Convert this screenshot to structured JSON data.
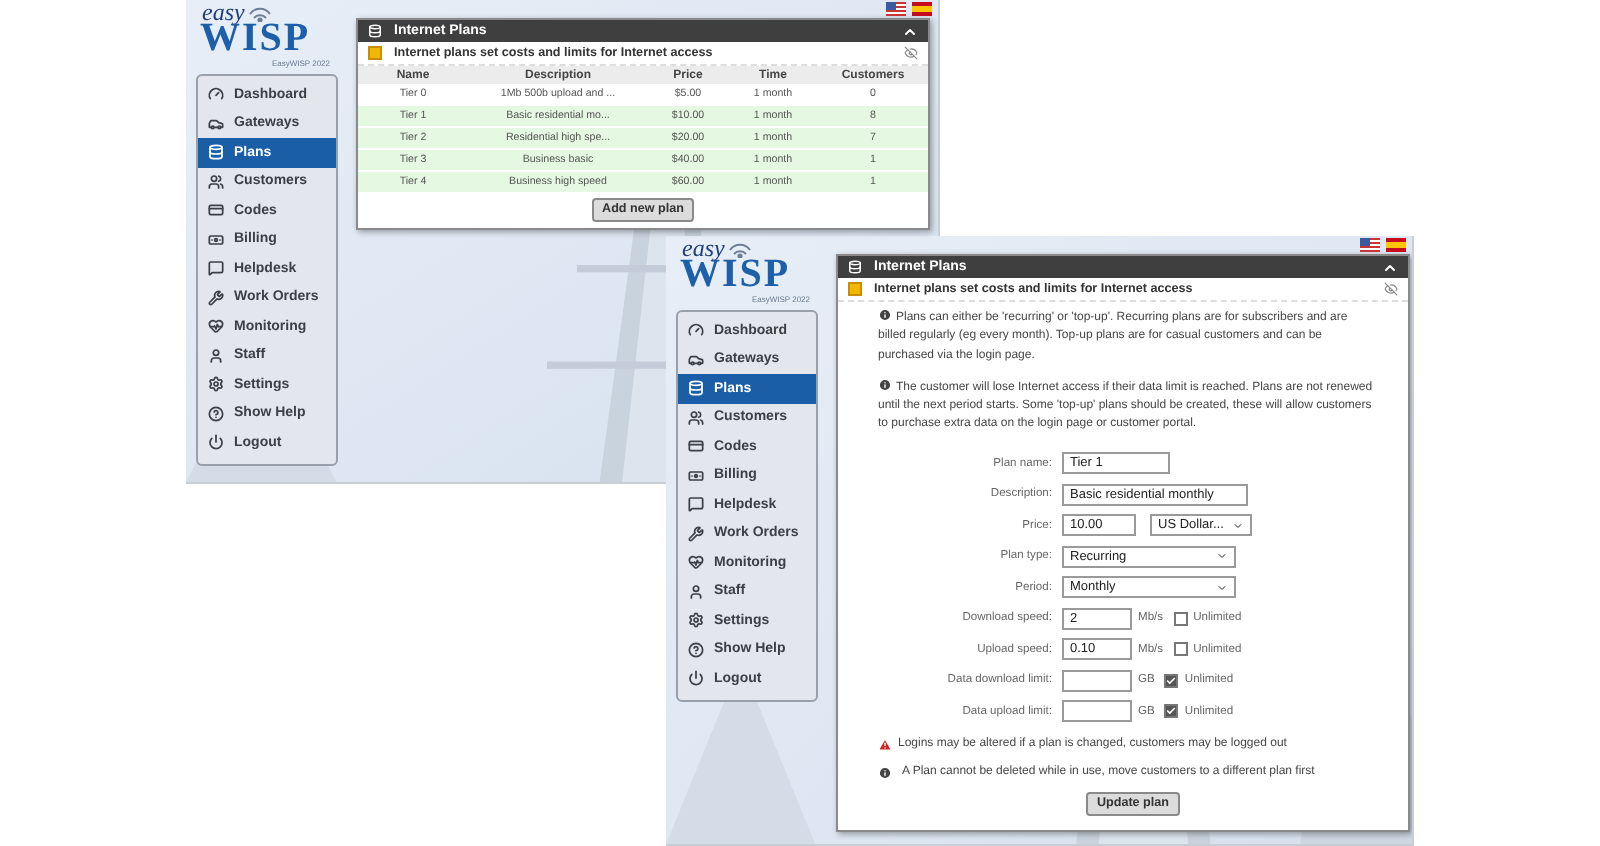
{
  "screens": [
    {
      "logo": {
        "script": "easy",
        "name": "WISP",
        "caption": "EasyWISP 2022"
      },
      "nav": [
        {
          "label": "Dashboard",
          "selected": false
        },
        {
          "label": "Gateways",
          "selected": false
        },
        {
          "label": "Plans",
          "selected": true
        },
        {
          "label": "Customers",
          "selected": false
        },
        {
          "label": "Codes",
          "selected": false
        },
        {
          "label": "Billing",
          "selected": false
        },
        {
          "label": "Helpdesk",
          "selected": false
        },
        {
          "label": "Work Orders",
          "selected": false
        },
        {
          "label": "Monitoring",
          "selected": false
        },
        {
          "label": "Staff",
          "selected": false
        },
        {
          "label": "Settings",
          "selected": false
        },
        {
          "label": "Show Help",
          "selected": false
        },
        {
          "label": "Logout",
          "selected": false
        }
      ],
      "panel": {
        "kind": "table",
        "title": "Internet Plans",
        "subtitle": "Internet plans set costs and limits for Internet access",
        "columns": [
          "Name",
          "Description",
          "Price",
          "Time",
          "Customers"
        ],
        "rows": [
          {
            "cells": [
              "Tier 0",
              "1Mb 500b upload and ...",
              "$5.00",
              "1 month",
              "0"
            ],
            "highlighted": false
          },
          {
            "cells": [
              "Tier 1",
              "Basic residential mo...",
              "$10.00",
              "1 month",
              "8"
            ],
            "highlighted": true
          },
          {
            "cells": [
              "Tier 2",
              "Residential high spe...",
              "$20.00",
              "1 month",
              "7"
            ],
            "highlighted": true
          },
          {
            "cells": [
              "Tier 3",
              "Business basic",
              "$40.00",
              "1 month",
              "1"
            ],
            "highlighted": true
          },
          {
            "cells": [
              "Tier 4",
              "Business high speed",
              "$60.00",
              "1 month",
              "1"
            ],
            "highlighted": true
          }
        ],
        "button": "Add new plan"
      }
    },
    {
      "logo": {
        "script": "easy",
        "name": "WISP",
        "caption": "EasyWISP 2022"
      },
      "nav": [
        {
          "label": "Dashboard",
          "selected": false
        },
        {
          "label": "Gateways",
          "selected": false
        },
        {
          "label": "Plans",
          "selected": true
        },
        {
          "label": "Customers",
          "selected": false
        },
        {
          "label": "Codes",
          "selected": false
        },
        {
          "label": "Billing",
          "selected": false
        },
        {
          "label": "Helpdesk",
          "selected": false
        },
        {
          "label": "Work Orders",
          "selected": false
        },
        {
          "label": "Monitoring",
          "selected": false
        },
        {
          "label": "Staff",
          "selected": false
        },
        {
          "label": "Settings",
          "selected": false
        },
        {
          "label": "Show Help",
          "selected": false
        },
        {
          "label": "Logout",
          "selected": false
        }
      ],
      "panel": {
        "kind": "form",
        "title": "Internet Plans",
        "subtitle": "Internet plans set costs and limits for Internet access",
        "intro_notes": [
          {
            "kind": "info",
            "text": "Plans can either be 'recurring' or 'top-up'. Recurring plans are for subscribers and are billed regularly (eg every month). Top-up plans are for casual customers and can be purchased via the login page."
          },
          {
            "kind": "info",
            "text": "The customer will lose Internet access if their data limit is reached. Plans are not renewed until the next period starts. Some 'top-up' plans should be created, these will allow customers to purchase extra data on the login page or customer portal."
          }
        ],
        "fields": [
          {
            "label": "Plan name:",
            "kind": "text",
            "value": "Tier 1"
          },
          {
            "label": "Description:",
            "kind": "text",
            "value": "Basic residential monthly"
          },
          {
            "label": "Price:",
            "kind": "price",
            "value": "10.00",
            "currency": "US Dollar..."
          },
          {
            "label": "Plan type:",
            "kind": "select",
            "value": "Recurring"
          },
          {
            "label": "Period:",
            "kind": "select",
            "value": "Monthly"
          },
          {
            "label": "Download speed:",
            "kind": "limit",
            "value": "2",
            "unit": "Mb/s",
            "option": "Unlimited",
            "checked": false
          },
          {
            "label": "Upload speed:",
            "kind": "limit",
            "value": "0.10",
            "unit": "Mb/s",
            "option": "Unlimited",
            "checked": false
          },
          {
            "label": "Data download limit:",
            "kind": "limit",
            "unit": "GB",
            "option": "Unlimited",
            "checked": true
          },
          {
            "label": "Data upload limit:",
            "kind": "limit",
            "unit": "GB",
            "option": "Unlimited",
            "checked": true
          }
        ],
        "footer_notes": [
          {
            "kind": "warning",
            "text": "Logins may be altered if a plan is changed, customers may be logged out"
          },
          {
            "kind": "info",
            "text": "A Plan cannot be deleted while in use, move customers to a different plan first"
          }
        ],
        "button": "Update plan"
      }
    }
  ]
}
